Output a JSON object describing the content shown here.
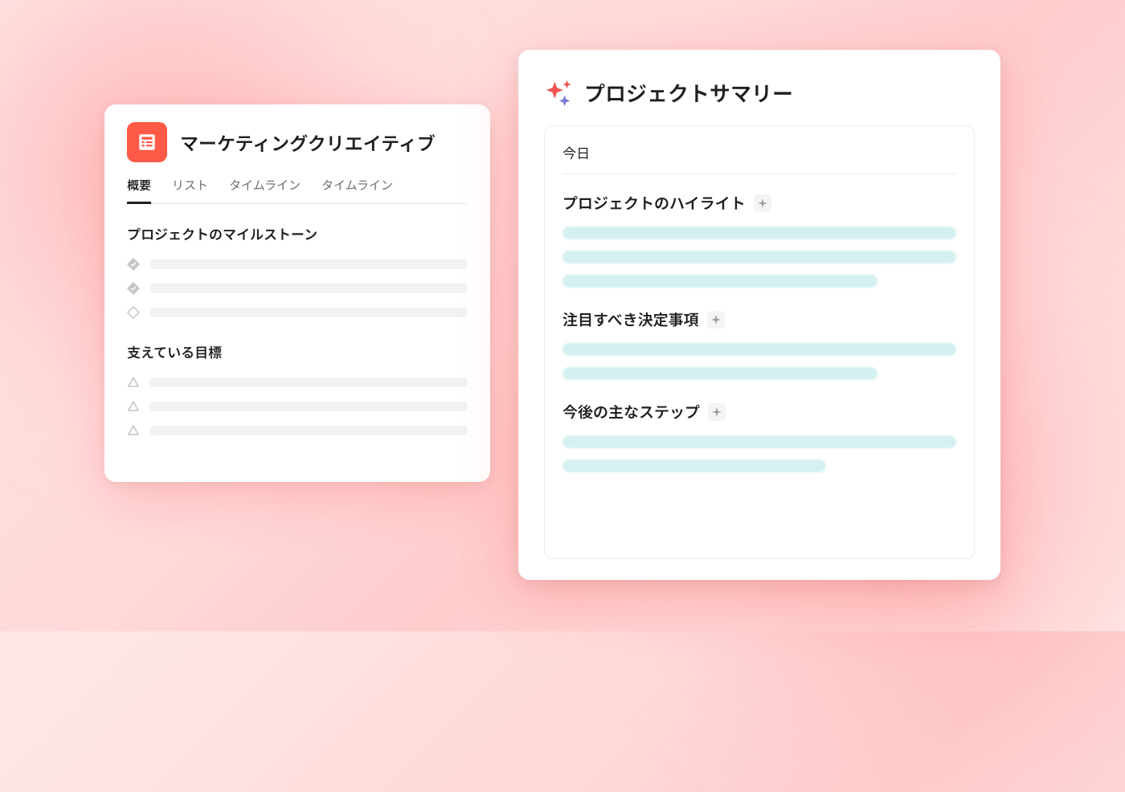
{
  "left_card": {
    "project_title": "マーケティングクリエイティブ",
    "tabs": [
      {
        "label": "概要",
        "active": true
      },
      {
        "label": "リスト",
        "active": false
      },
      {
        "label": "タイムライン",
        "active": false
      },
      {
        "label": "タイムライン",
        "active": false
      }
    ],
    "sections": {
      "milestones": {
        "title": "プロジェクトのマイルストーン",
        "items": [
          {
            "state": "done"
          },
          {
            "state": "done"
          },
          {
            "state": "open"
          }
        ]
      },
      "goals": {
        "title": "支えている目標",
        "items": [
          {
            "state": "triangle"
          },
          {
            "state": "triangle"
          },
          {
            "state": "triangle"
          }
        ]
      }
    }
  },
  "right_card": {
    "title": "プロジェクトサマリー",
    "date_label": "今日",
    "subsections": [
      {
        "heading": "プロジェクトのハイライト"
      },
      {
        "heading": "注目すべき決定事項"
      },
      {
        "heading": "今後の主なステップ"
      }
    ]
  }
}
